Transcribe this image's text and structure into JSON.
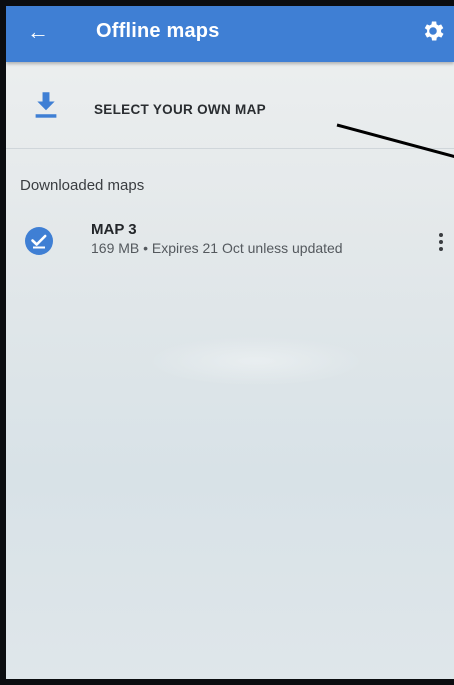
{
  "appbar": {
    "title": "Offline maps",
    "back_icon": "back-arrow-icon",
    "settings_icon": "gear-icon",
    "color": "#3f7fd4"
  },
  "select_map": {
    "label": "SELECT YOUR OWN MAP",
    "icon": "download-icon"
  },
  "downloaded": {
    "header": "Downloaded maps",
    "items": [
      {
        "name": "MAP 3",
        "meta": "169 MB • Expires 21 Oct unless updated",
        "status_icon": "check-circle-icon",
        "menu_icon": "more-vert-icon"
      }
    ]
  },
  "colors": {
    "accent": "#3f7fd4",
    "text_primary": "#23262a",
    "text_secondary": "#54595e"
  }
}
